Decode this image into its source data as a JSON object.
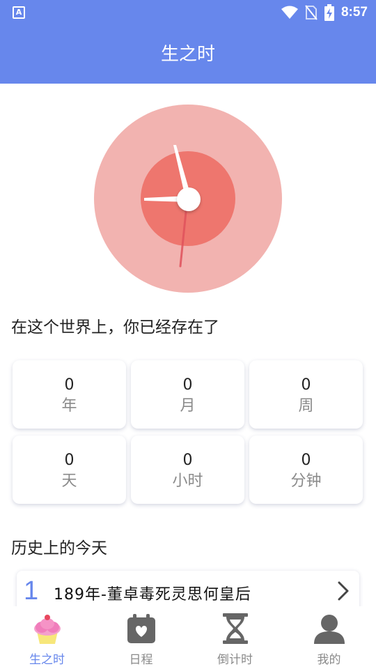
{
  "status_bar": {
    "time": "8:57",
    "left_icon": "A"
  },
  "header": {
    "title": "生之时"
  },
  "alive_section": {
    "title": "在这个世界上，你已经存在了"
  },
  "stats": [
    {
      "value": "0",
      "unit": "年"
    },
    {
      "value": "0",
      "unit": "月"
    },
    {
      "value": "0",
      "unit": "周"
    },
    {
      "value": "0",
      "unit": "天"
    },
    {
      "value": "0",
      "unit": "小时"
    },
    {
      "value": "0",
      "unit": "分钟"
    }
  ],
  "history_section": {
    "title": "历史上的今天"
  },
  "history_items": [
    {
      "index": "1",
      "text": "189年-董卓毒死灵思何皇后"
    }
  ],
  "tabs": [
    {
      "label": "生之时",
      "icon": "cupcake-icon",
      "active": true
    },
    {
      "label": "日程",
      "icon": "calendar-heart-icon",
      "active": false
    },
    {
      "label": "倒计时",
      "icon": "hourglass-icon",
      "active": false
    },
    {
      "label": "我的",
      "icon": "user-icon",
      "active": false
    }
  ],
  "colors": {
    "accent": "#6787ec",
    "clock_outer": "#f2b3b0",
    "clock_inner": "#ee766e"
  }
}
